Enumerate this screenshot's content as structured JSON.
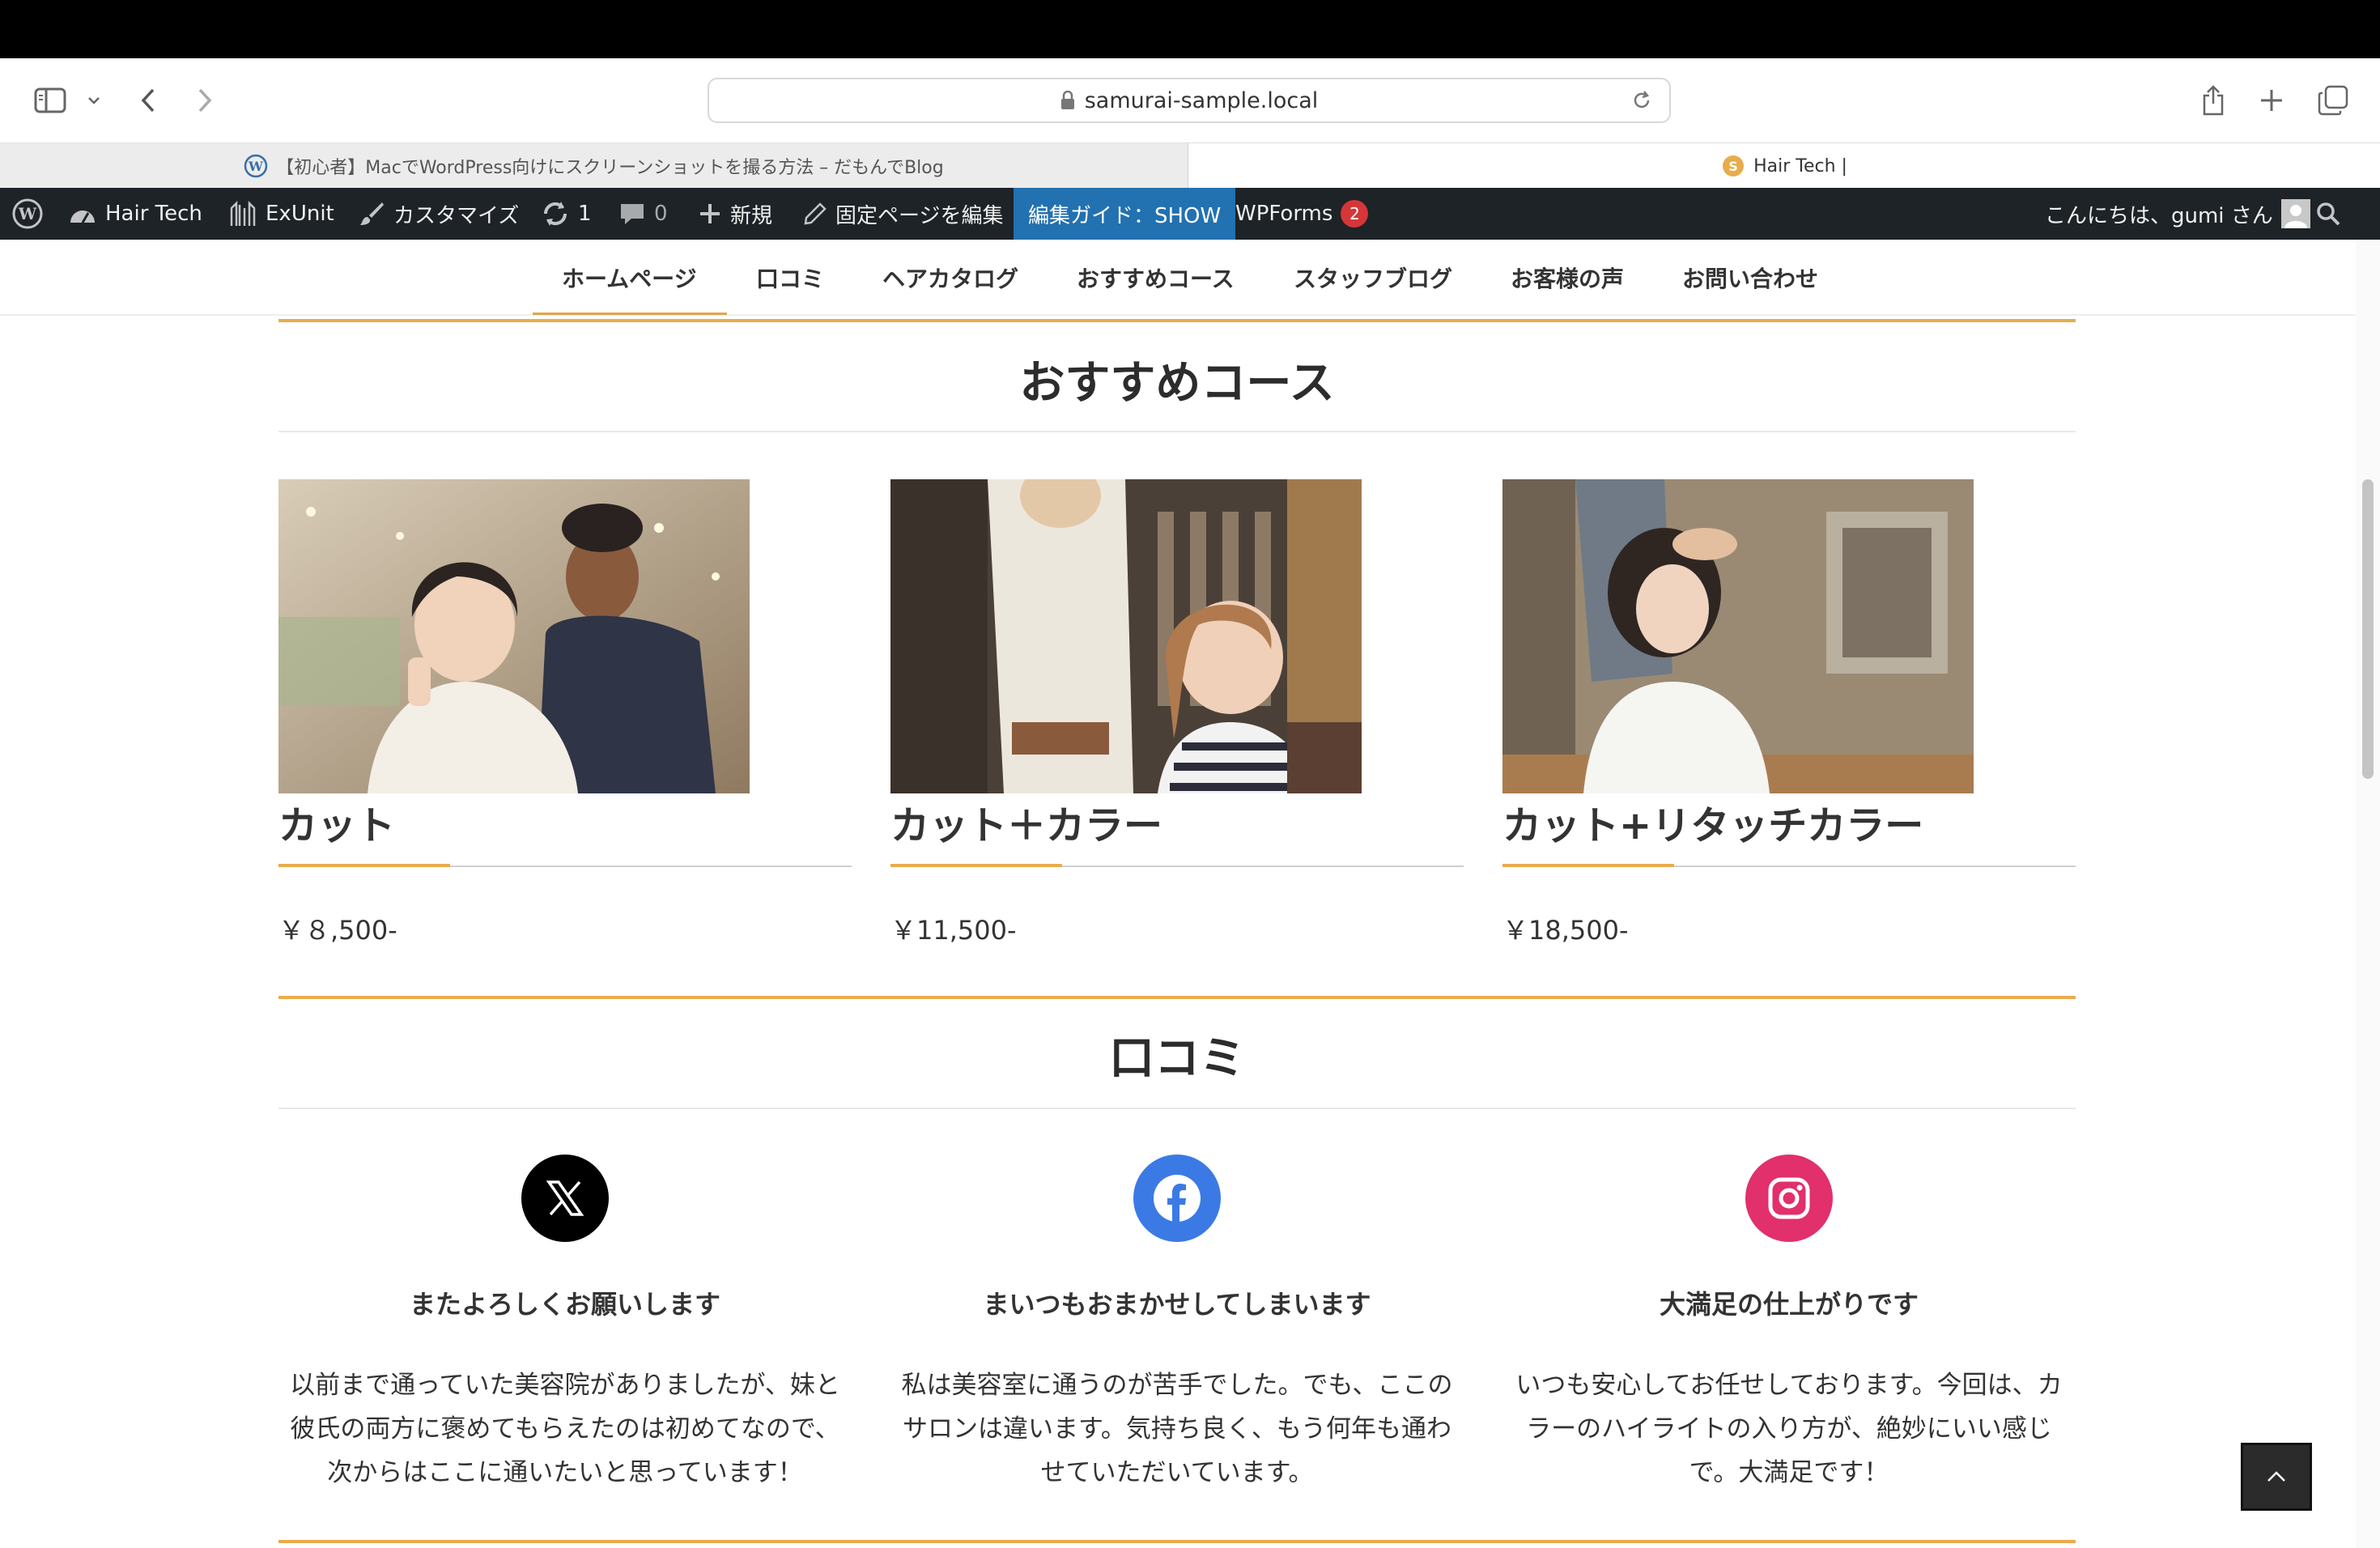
{
  "browser": {
    "url": "samurai-sample.local",
    "tabs": [
      {
        "title": "【初心者】MacでWordPress向けにスクリーンショットを撮る方法 – だもんでBlog",
        "active": false
      },
      {
        "title": "Hair Tech |",
        "active": true
      }
    ]
  },
  "adminbar": {
    "site_name": "Hair Tech",
    "exunit": "ExUnit",
    "customize": "カスタマイズ",
    "updates_count": "1",
    "comments_count": "0",
    "new": "新規",
    "edit_page": "固定ページを編集",
    "guide": "編集ガイド：SHOW",
    "wpforms": "WPForms",
    "wpforms_badge": "2",
    "greeting": "こんにちは、gumi さん"
  },
  "nav": {
    "items": [
      "ホームページ",
      "口コミ",
      "ヘアカタログ",
      "おすすめコース",
      "スタッフブログ",
      "お客様の声",
      "お問い合わせ"
    ]
  },
  "courses": {
    "heading": "おすすめコース",
    "items": [
      {
        "name": "カット",
        "price": "￥８,500-"
      },
      {
        "name": "カット＋カラー",
        "price": "￥11,500-"
      },
      {
        "name": "カット+リタッチカラー",
        "price": "￥18,500-"
      }
    ]
  },
  "reviews": {
    "heading": "口コミ",
    "items": [
      {
        "icon": "x-logo-icon",
        "color": "#000000",
        "title": "またよろしくお願いします",
        "lines": [
          "以前まで通っていた美容院がありましたが、妹と",
          "彼氏の両方に褒めてもらえたのは初めてなので、",
          "次からはここに通いたいと思っています！"
        ]
      },
      {
        "icon": "facebook-icon",
        "color": "#3b7ae5",
        "title": "まいつもおまかせしてしまいます",
        "lines": [
          "私は美容室に通うのが苦手でした。でも、ここの",
          "サロンは違います。気持ち良く、もう何年も通わ",
          "せていただいています。"
        ]
      },
      {
        "icon": "instagram-icon",
        "color": "#e1306c",
        "title": "大満足の仕上がりです",
        "lines": [
          "いつも安心してお任せしております。今回は、カ",
          "ラーのハイライトの入り方が、絶妙にいい感じ",
          "で。大満足です！"
        ]
      }
    ]
  },
  "colors": {
    "accent": "#e8ac4c",
    "adminbar_bg": "#1d2327",
    "guide_bg": "#2271b1"
  }
}
